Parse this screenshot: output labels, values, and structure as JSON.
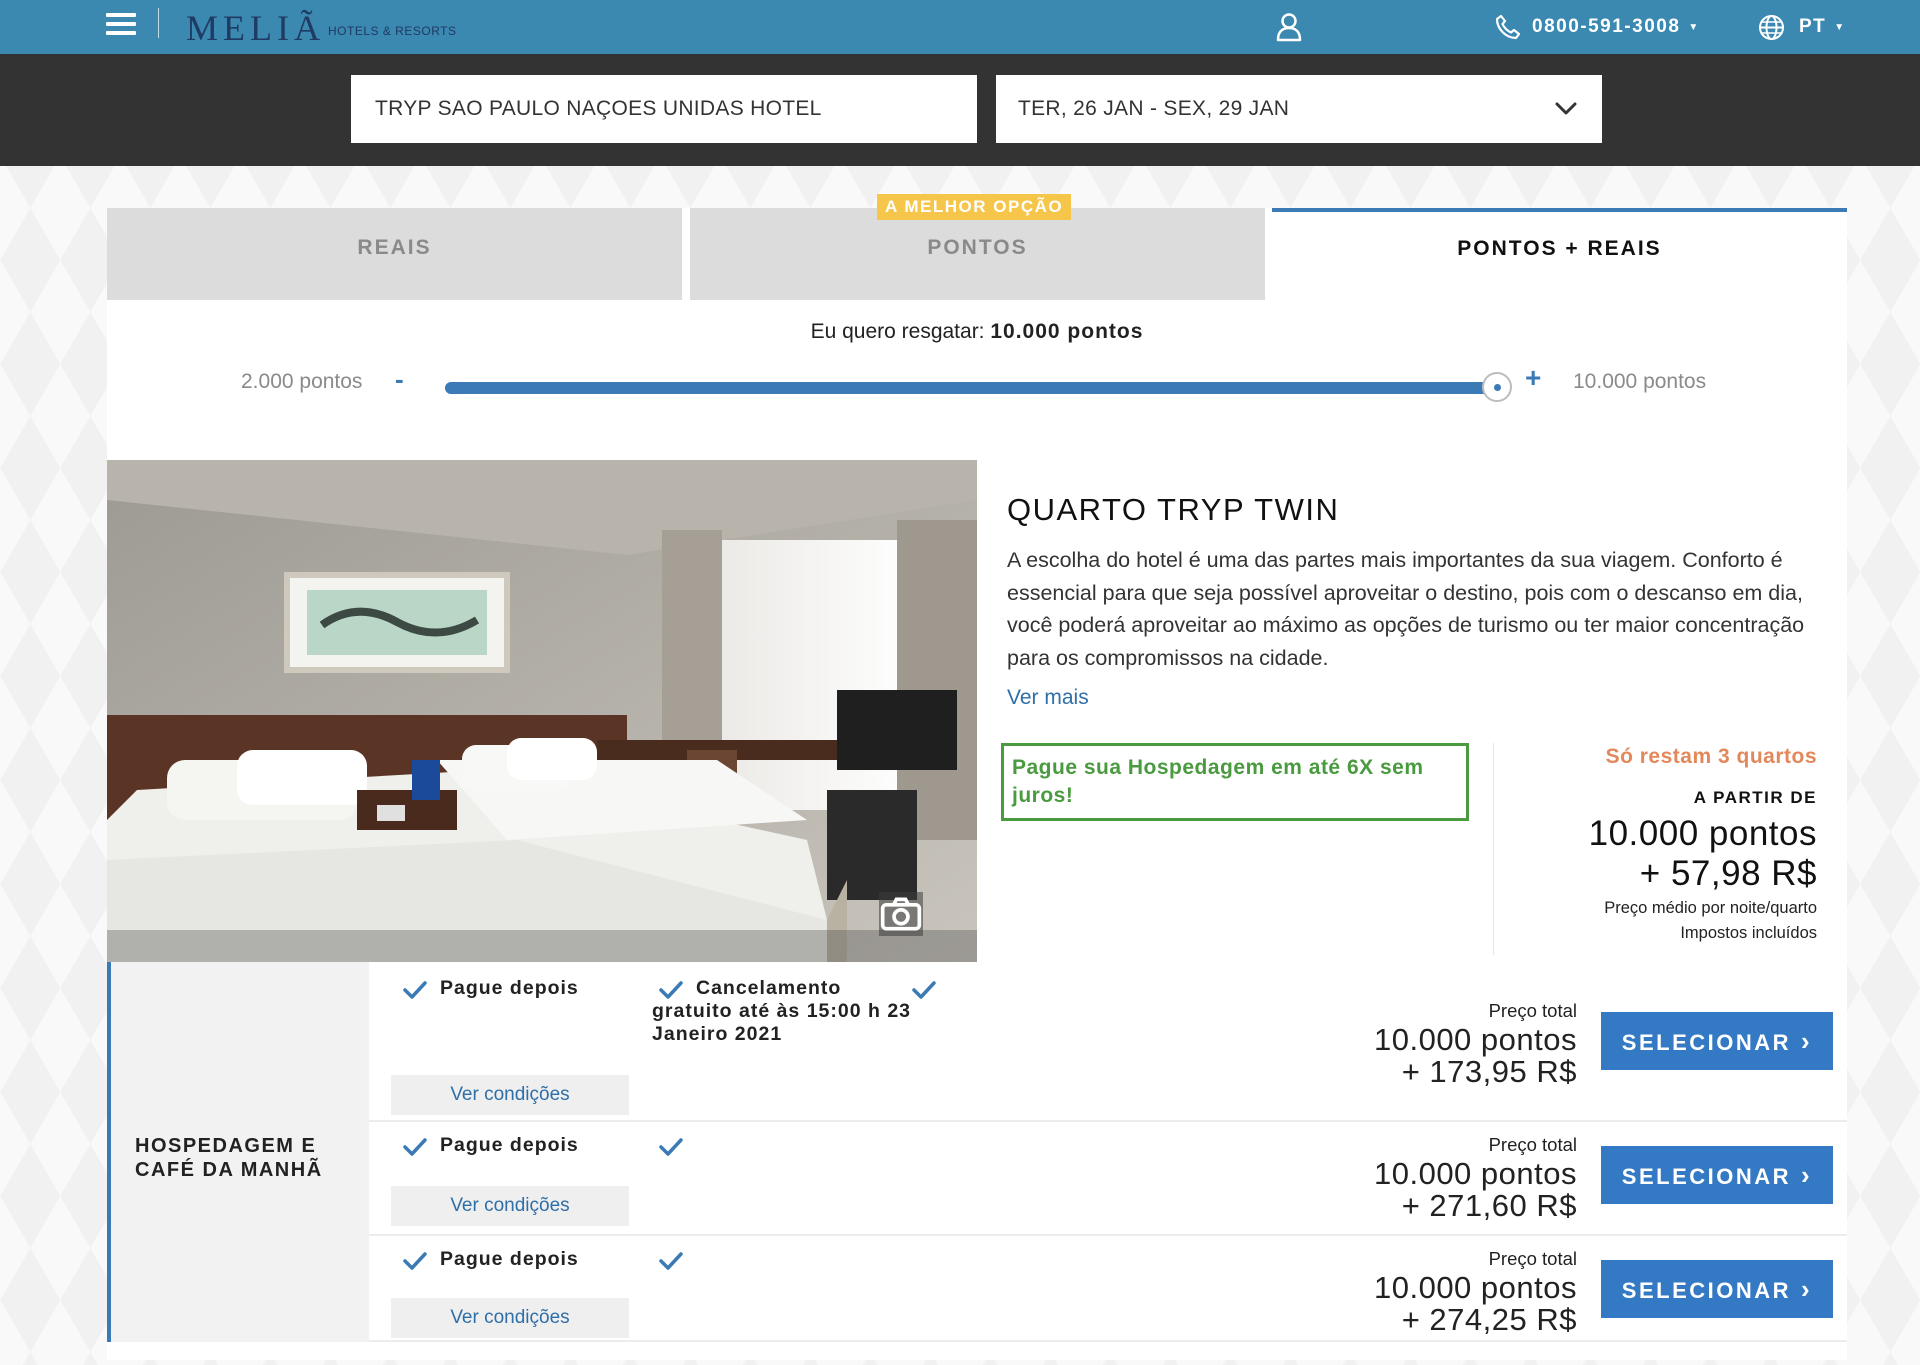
{
  "header": {
    "brand": "MELIÃ",
    "brand_sub": "HOTELS & RESORTS",
    "phone": "0800-591-3008",
    "language": "PT",
    "colors": {
      "bar": "#3b88b0",
      "logo": "#1f3a63"
    }
  },
  "search": {
    "hotel": "TRYP SAO PAULO NAÇOES UNIDAS HOTEL",
    "dates": "TER, 26 JAN - SEX, 29 JAN"
  },
  "tabs": [
    {
      "label": "REAIS"
    },
    {
      "label": "PONTOS",
      "badge": "A MELHOR OPÇÃO"
    },
    {
      "label": "PONTOS + REAIS",
      "active": true
    }
  ],
  "slider": {
    "prefix": "Eu quero resgatar: ",
    "value_label": "10.000 pontos",
    "min_label": "2.000 pontos",
    "max_label": "10.000 pontos",
    "minus": "-",
    "plus": "+",
    "min": 2000,
    "max": 10000,
    "value": 10000
  },
  "room": {
    "title": "QUARTO TRYP TWIN",
    "description": "A escolha do hotel é uma das partes mais importantes da sua viagem. Conforto é essencial para que seja possível aproveitar o destino, pois com o descanso em dia, você poderá aproveitar ao máximo as opções de turismo ou ter maior concentração para os compromissos na cidade.",
    "more_link": "Ver mais",
    "promo": "Pague sua Hospedagem em até 6X sem juros!",
    "availability": "Só restam 3 quartos",
    "from_label": "A PARTIR DE",
    "from_points": "10.000 pontos",
    "from_money": "+ 57,98 R$",
    "avg_note": "Preço médio por noite/quarto",
    "tax_note": "Impostos incluídos"
  },
  "rates": {
    "board": "HOSPEDAGEM E CAFÉ DA MANHÃ",
    "rows": [
      {
        "option": "Pague depois",
        "cancel": "Cancelamento gratuito até às 15:00 h 23 Janeiro 2021",
        "conditions": "Ver condições",
        "total_label": "Preço total",
        "points": "10.000 pontos",
        "money": "+ 173,95 R$",
        "button": "SELECIONAR"
      },
      {
        "option": "Pague depois",
        "conditions": "Ver condições",
        "total_label": "Preço total",
        "points": "10.000 pontos",
        "money": "+ 271,60 R$",
        "button": "SELECIONAR"
      },
      {
        "option": "Pague depois",
        "conditions": "Ver condições",
        "total_label": "Preço total",
        "points": "10.000 pontos",
        "money": "+ 274,25 R$",
        "button": "SELECIONAR"
      }
    ]
  }
}
